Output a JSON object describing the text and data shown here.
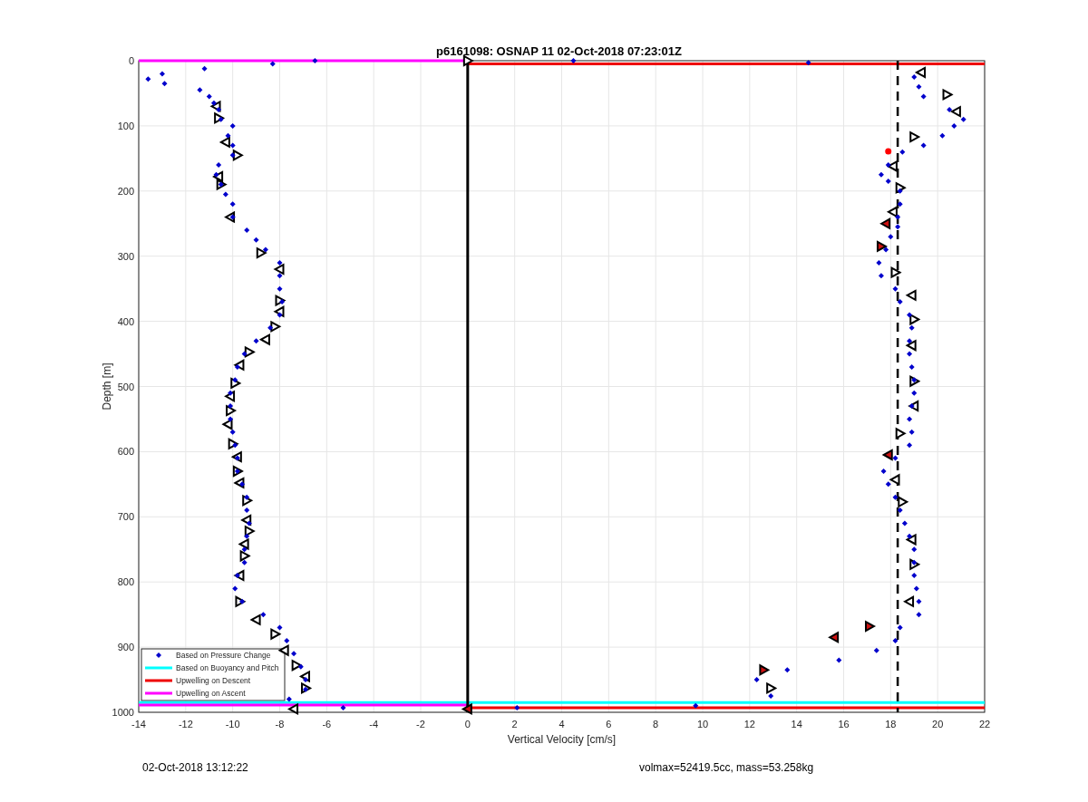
{
  "figure": {
    "chart_data": {
      "type": "scatter",
      "title": "p6161098: OSNAP 11 02-Oct-2018 07:23:01Z",
      "xlabel": "Vertical Velocity [cm/s]",
      "ylabel": "Depth [m]",
      "xlim": [
        -14,
        22
      ],
      "ylim": [
        1000,
        0
      ],
      "xticks": [
        -14,
        -12,
        -10,
        -8,
        -6,
        -4,
        -2,
        0,
        2,
        4,
        6,
        8,
        10,
        12,
        14,
        16,
        18,
        20,
        22
      ],
      "yticks": [
        0,
        100,
        200,
        300,
        400,
        500,
        600,
        700,
        800,
        900,
        1000
      ],
      "grid": true,
      "legend": true,
      "series": [
        {
          "name": "Based on Pressure Change",
          "type": "scatter",
          "color": "#0000cc",
          "marker": "diamond",
          "x": [
            -6.5,
            -8.3,
            -11.2,
            -13,
            -13.6,
            -12.9,
            -11.4,
            -11,
            -10.8,
            -10.6,
            -10.5,
            -10,
            -10.2,
            -10,
            -10,
            -10.6,
            -10.7,
            -10.5,
            -10.3,
            -10,
            -10,
            -9.4,
            -9,
            -8.6,
            -8,
            -8,
            -8,
            -7.9,
            -8,
            -8.4,
            -9,
            -9.5,
            -9.8,
            -9.9,
            -10.1,
            -10.1,
            -10.1,
            -10,
            -9.9,
            -9.8,
            -9.8,
            -9.6,
            -9.4,
            -9.4,
            -9.3,
            -9.4,
            -9.5,
            -9.5,
            -9.8,
            -9.9,
            -9.6,
            -8.7,
            -8,
            -7.7,
            -7.4,
            -7.1,
            -6.9,
            -6.9,
            -7.6,
            -5.3,
            4.5,
            14.5,
            19,
            19.2,
            19.4,
            20.5,
            21.1,
            20.7,
            20.2,
            19.4,
            18.5,
            17.9,
            17.6,
            17.9,
            18.4,
            18.4,
            18.3,
            18.3,
            18,
            17.8,
            17.5,
            17.6,
            18.2,
            18.4,
            18.8,
            18.9,
            18.8,
            18.8,
            18.9,
            19,
            19,
            18.9,
            18.8,
            18.9,
            18.8,
            18.2,
            17.7,
            17.9,
            18.2,
            18.4,
            18.6,
            18.8,
            19,
            19,
            19,
            19.1,
            19.2,
            19.2,
            18.4,
            18.2,
            17.4,
            15.8,
            13.6,
            12.3,
            12.9,
            9.7,
            2.1
          ],
          "values": [
            0,
            5,
            12,
            20,
            28,
            35,
            45,
            55,
            65,
            75,
            90,
            100,
            115,
            130,
            145,
            160,
            175,
            190,
            205,
            220,
            240,
            260,
            275,
            290,
            310,
            330,
            350,
            370,
            390,
            410,
            430,
            450,
            470,
            490,
            510,
            530,
            550,
            570,
            590,
            610,
            630,
            650,
            670,
            690,
            710,
            730,
            750,
            770,
            790,
            810,
            830,
            850,
            870,
            890,
            910,
            930,
            950,
            965,
            980,
            993,
            0,
            3,
            25,
            40,
            55,
            75,
            90,
            100,
            115,
            130,
            140,
            160,
            175,
            185,
            200,
            220,
            240,
            255,
            270,
            290,
            310,
            330,
            350,
            370,
            390,
            410,
            430,
            450,
            470,
            490,
            510,
            530,
            550,
            570,
            590,
            610,
            630,
            650,
            670,
            690,
            710,
            730,
            750,
            770,
            790,
            810,
            830,
            850,
            870,
            890,
            905,
            920,
            935,
            950,
            975,
            990,
            993
          ]
        },
        {
          "name": "Based on Buoyancy and Pitch",
          "type": "line",
          "color": "#00ffff",
          "x": [
            -14,
            22
          ],
          "values": [
            985,
            985
          ]
        },
        {
          "name": "Upwelling on Descent",
          "type": "line",
          "color": "#ee0000",
          "x": [
            0,
            22
          ],
          "values": [
            5,
            5
          ]
        },
        {
          "name": "Upwelling on Ascent",
          "type": "line",
          "color": "#ff00ff",
          "x": [
            -14,
            0
          ],
          "values": [
            0,
            0
          ]
        },
        {
          "type": "line",
          "color": "#ff00ff",
          "x": [
            -14,
            0
          ],
          "values": [
            989,
            989
          ]
        },
        {
          "type": "line",
          "color": "#ee0000",
          "x": [
            0,
            22
          ],
          "values": [
            993,
            993
          ]
        },
        {
          "type": "line",
          "color": "#000000",
          "x": [
            0,
            0
          ],
          "values": [
            0,
            1000
          ]
        },
        {
          "type": "line",
          "color": "#000000",
          "line_style": "dashed",
          "x": [
            18.3,
            18.3
          ],
          "values": [
            0,
            1000
          ]
        },
        {
          "type": "scatter",
          "color": "#ffffff",
          "marker": "triangle",
          "x": [
            -10.7,
            -10.6,
            -10.3,
            -9.8,
            -10.6,
            -10.5,
            -10.1,
            -8.8,
            -8,
            -8,
            -8,
            -8.2,
            -8.6,
            -9.3,
            -9.7,
            -9.9,
            -10.1,
            -10.1,
            -10.2,
            -10,
            -9.8,
            -9.8,
            -9.7,
            -9.4,
            -9.4,
            -9.3,
            -9.5,
            -9.5,
            -9.7,
            -9.7,
            -9,
            -8.2,
            -7.8,
            -7.3,
            -6.9,
            -6.9,
            -7.4,
            0,
            19.3,
            20.4,
            20.8,
            19,
            18.1,
            18.4,
            18.1,
            18.2,
            18.9,
            19,
            18.9,
            19,
            19,
            18.4,
            18.2,
            18.5,
            18.9,
            19,
            18.8,
            12.9
          ],
          "values": [
            70,
            88,
            125,
            145,
            178,
            190,
            240,
            295,
            320,
            368,
            385,
            408,
            428,
            447,
            467,
            495,
            515,
            537,
            558,
            588,
            608,
            630,
            648,
            675,
            705,
            722,
            742,
            760,
            790,
            830,
            858,
            880,
            905,
            928,
            945,
            963,
            995,
            0,
            18,
            52,
            78,
            117,
            162,
            195,
            232,
            325,
            360,
            397,
            437,
            492,
            530,
            572,
            643,
            677,
            735,
            773,
            830,
            963
          ]
        },
        {
          "type": "scatter",
          "color": "#cc1111",
          "marker": "triangle",
          "x": [
            17.8,
            17.6,
            17.9,
            17.1,
            15.6,
            12.6,
            0
          ],
          "values": [
            250,
            285,
            605,
            868,
            885,
            935,
            995
          ]
        },
        {
          "type": "scatter",
          "color": "#ff0000",
          "marker": "circle",
          "x": [
            17.9
          ],
          "values": [
            139
          ]
        }
      ]
    }
  },
  "footer": {
    "timestamp": "02-Oct-2018 13:12:22",
    "info": "volmax=52419.5cc, mass=53.258kg"
  }
}
